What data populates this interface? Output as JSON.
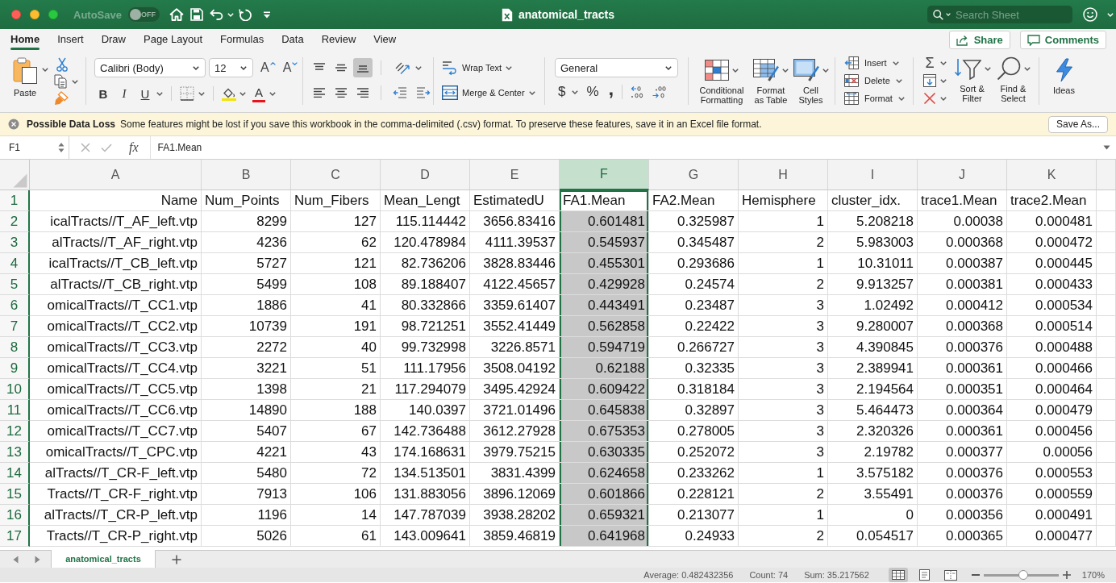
{
  "window": {
    "title": "anatomical_tracts"
  },
  "title_bar": {
    "autosave": {
      "label": "AutoSave",
      "state_label": "OFF",
      "on": false
    },
    "search": {
      "placeholder": "Search Sheet"
    }
  },
  "ribbon_tabs": [
    {
      "label": "Home",
      "selected": true
    },
    {
      "label": "Insert",
      "selected": false
    },
    {
      "label": "Draw",
      "selected": false
    },
    {
      "label": "Page Layout",
      "selected": false
    },
    {
      "label": "Formulas",
      "selected": false
    },
    {
      "label": "Data",
      "selected": false
    },
    {
      "label": "Review",
      "selected": false
    },
    {
      "label": "View",
      "selected": false
    }
  ],
  "ribbon_actions": [
    {
      "kind": "share",
      "label": "Share"
    },
    {
      "kind": "comments",
      "label": "Comments"
    }
  ],
  "ribbon": {
    "clipboard": {
      "paste": "Paste"
    },
    "font": {
      "family": "Calibri (Body)",
      "size": "12",
      "grow": "A",
      "shrink": "A",
      "styles": [
        {
          "kind": "bold",
          "label": "B"
        },
        {
          "kind": "italic",
          "label": "I"
        },
        {
          "kind": "underline",
          "label": "U"
        }
      ],
      "font_color": "A"
    },
    "alignment": {
      "buttons": [
        {
          "kind": "top",
          "selected": false
        },
        {
          "kind": "middle",
          "selected": false
        },
        {
          "kind": "bottom",
          "selected": true
        },
        {
          "kind": "left",
          "selected": false
        },
        {
          "kind": "center",
          "selected": false
        },
        {
          "kind": "right",
          "selected": false
        }
      ],
      "wrap_text": "Wrap Text",
      "merge": "Merge & Center"
    },
    "number": {
      "format": "General",
      "currency": "$",
      "percent": "%",
      "comma": ","
    },
    "styles": [
      {
        "kind": "conditional",
        "label": "Conditional Formatting"
      },
      {
        "kind": "table",
        "label": "Format as Table"
      },
      {
        "kind": "cell",
        "label": "Cell Styles"
      }
    ],
    "cells": [
      {
        "kind": "insert",
        "label": "Insert"
      },
      {
        "kind": "delete",
        "label": "Delete"
      },
      {
        "kind": "format",
        "label": "Format"
      }
    ],
    "editing": {
      "autosum": "Σ",
      "sort": "Sort & Filter",
      "find": "Find & Select"
    },
    "ideas": "Ideas"
  },
  "message_bar": {
    "title": "Possible Data Loss",
    "text": "Some features might be lost if you save this workbook in the comma-delimited (.csv) format. To preserve these features, save it in an Excel file format.",
    "button": "Save As..."
  },
  "formula_bar": {
    "name_box": "F1",
    "function_label": "fx",
    "formula": "FA1.Mean"
  },
  "sheet": {
    "columns": [
      {
        "label": "A",
        "selected": false
      },
      {
        "label": "B",
        "selected": false
      },
      {
        "label": "C",
        "selected": false
      },
      {
        "label": "D",
        "selected": false
      },
      {
        "label": "E",
        "selected": false
      },
      {
        "label": "F",
        "selected": true
      },
      {
        "label": "G",
        "selected": false
      },
      {
        "label": "H",
        "selected": false
      },
      {
        "label": "I",
        "selected": false
      },
      {
        "label": "J",
        "selected": false
      },
      {
        "label": "K",
        "selected": false
      }
    ],
    "rows": [
      {
        "number": "1",
        "highlighted": true,
        "active": true,
        "cells": [
          "Name",
          "Num_Points",
          "Num_Fibers",
          "Mean_Lengt",
          "EstimatedU",
          "FA1.Mean",
          "FA2.Mean",
          "Hemisphere",
          "cluster_idx.",
          "trace1.Mean",
          "trace2.Mean"
        ]
      },
      {
        "number": "2",
        "highlighted": true,
        "active": false,
        "cells": [
          "icalTracts//T_AF_left.vtp",
          "8299",
          "127",
          "115.114442",
          "3656.83416",
          "0.601481",
          "0.325987",
          "1",
          "5.208218",
          "0.00038",
          "0.000481"
        ]
      },
      {
        "number": "3",
        "highlighted": true,
        "active": false,
        "cells": [
          "alTracts//T_AF_right.vtp",
          "4236",
          "62",
          "120.478984",
          "4111.39537",
          "0.545937",
          "0.345487",
          "2",
          "5.983003",
          "0.000368",
          "0.000472"
        ]
      },
      {
        "number": "4",
        "highlighted": true,
        "active": false,
        "cells": [
          "icalTracts//T_CB_left.vtp",
          "5727",
          "121",
          "82.736206",
          "3828.83446",
          "0.455301",
          "0.293686",
          "1",
          "10.31011",
          "0.000387",
          "0.000445"
        ]
      },
      {
        "number": "5",
        "highlighted": true,
        "active": false,
        "cells": [
          "alTracts//T_CB_right.vtp",
          "5499",
          "108",
          "89.188407",
          "4122.45657",
          "0.429928",
          "0.24574",
          "2",
          "9.913257",
          "0.000381",
          "0.000433"
        ]
      },
      {
        "number": "6",
        "highlighted": true,
        "active": false,
        "cells": [
          "omicalTracts//T_CC1.vtp",
          "1886",
          "41",
          "80.332866",
          "3359.61407",
          "0.443491",
          "0.23487",
          "3",
          "1.02492",
          "0.000412",
          "0.000534"
        ]
      },
      {
        "number": "7",
        "highlighted": true,
        "active": false,
        "cells": [
          "omicalTracts//T_CC2.vtp",
          "10739",
          "191",
          "98.721251",
          "3552.41449",
          "0.562858",
          "0.22422",
          "3",
          "9.280007",
          "0.000368",
          "0.000514"
        ]
      },
      {
        "number": "8",
        "highlighted": true,
        "active": false,
        "cells": [
          "omicalTracts//T_CC3.vtp",
          "2272",
          "40",
          "99.732998",
          "3226.8571",
          "0.594719",
          "0.266727",
          "3",
          "4.390845",
          "0.000376",
          "0.000488"
        ]
      },
      {
        "number": "9",
        "highlighted": true,
        "active": false,
        "cells": [
          "omicalTracts//T_CC4.vtp",
          "3221",
          "51",
          "111.17956",
          "3508.04192",
          "0.62188",
          "0.32335",
          "3",
          "2.389941",
          "0.000361",
          "0.000466"
        ]
      },
      {
        "number": "10",
        "highlighted": true,
        "active": false,
        "cells": [
          "omicalTracts//T_CC5.vtp",
          "1398",
          "21",
          "117.294079",
          "3495.42924",
          "0.609422",
          "0.318184",
          "3",
          "2.194564",
          "0.000351",
          "0.000464"
        ]
      },
      {
        "number": "11",
        "highlighted": true,
        "active": false,
        "cells": [
          "omicalTracts//T_CC6.vtp",
          "14890",
          "188",
          "140.0397",
          "3721.01496",
          "0.645838",
          "0.32897",
          "3",
          "5.464473",
          "0.000364",
          "0.000479"
        ]
      },
      {
        "number": "12",
        "highlighted": true,
        "active": false,
        "cells": [
          "omicalTracts//T_CC7.vtp",
          "5407",
          "67",
          "142.736488",
          "3612.27928",
          "0.675353",
          "0.278005",
          "3",
          "2.320326",
          "0.000361",
          "0.000456"
        ]
      },
      {
        "number": "13",
        "highlighted": true,
        "active": false,
        "cells": [
          "omicalTracts//T_CPC.vtp",
          "4221",
          "43",
          "174.168631",
          "3979.75215",
          "0.630335",
          "0.252072",
          "3",
          "2.19782",
          "0.000377",
          "0.00056"
        ]
      },
      {
        "number": "14",
        "highlighted": true,
        "active": false,
        "cells": [
          "alTracts//T_CR-F_left.vtp",
          "5480",
          "72",
          "134.513501",
          "3831.4399",
          "0.624658",
          "0.233262",
          "1",
          "3.575182",
          "0.000376",
          "0.000553"
        ]
      },
      {
        "number": "15",
        "highlighted": true,
        "active": false,
        "cells": [
          "Tracts//T_CR-F_right.vtp",
          "7913",
          "106",
          "131.883056",
          "3896.12069",
          "0.601866",
          "0.228121",
          "2",
          "3.55491",
          "0.000376",
          "0.000559"
        ]
      },
      {
        "number": "16",
        "highlighted": true,
        "active": false,
        "cells": [
          "alTracts//T_CR-P_left.vtp",
          "1196",
          "14",
          "147.787039",
          "3938.28202",
          "0.659321",
          "0.213077",
          "1",
          "0",
          "0.000356",
          "0.000491"
        ]
      },
      {
        "number": "17",
        "highlighted": true,
        "active": false,
        "cells": [
          "Tracts//T_CR-P_right.vtp",
          "5026",
          "61",
          "143.009641",
          "3859.46819",
          "0.641968",
          "0.24933",
          "2",
          "0.054517",
          "0.000365",
          "0.000477"
        ]
      }
    ]
  },
  "sheet_tabs": [
    {
      "label": "anatomical_tracts",
      "selected": true
    }
  ],
  "status_bar": {
    "average": "Average: 0.482432356",
    "count": "Count: 74",
    "sum": "Sum: 35.217562",
    "views": [
      {
        "kind": "normal",
        "selected": true
      },
      {
        "kind": "page_layout",
        "selected": false
      },
      {
        "kind": "page_break",
        "selected": false
      }
    ],
    "zoom": {
      "level": 0.53,
      "label": "170%"
    }
  }
}
